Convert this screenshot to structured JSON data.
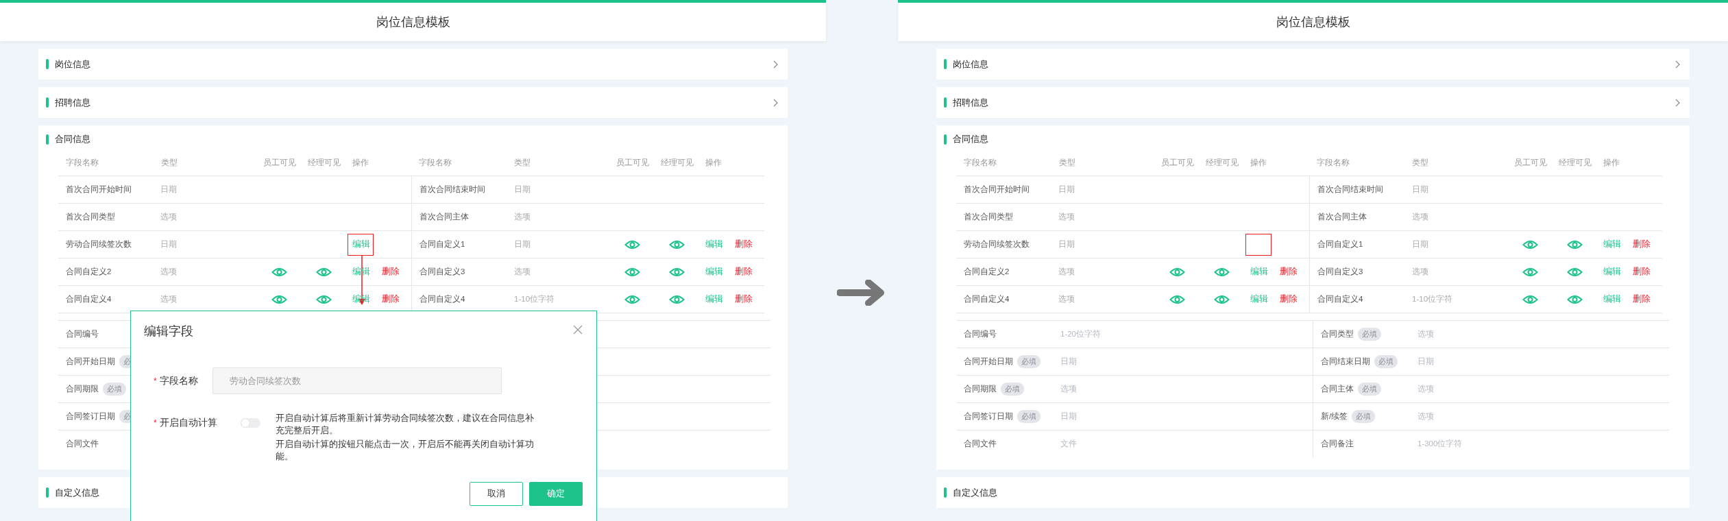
{
  "screens": [
    {
      "title": "岗位信息模板",
      "collapsed_sections": [
        {
          "title": "岗位信息"
        },
        {
          "title": "招聘信息"
        }
      ],
      "contract": {
        "title": "合同信息",
        "column_groups": [
          [
            "字段名称",
            "类型",
            "员工可见",
            "经理可见",
            "操作"
          ],
          [
            "字段名称",
            "类型",
            "员工可见",
            "经理可见",
            "操作"
          ]
        ],
        "rows": [
          {
            "left": {
              "name": "首次合同开始时间",
              "type": "日期",
              "employee_visible": false,
              "manager_visible": false,
              "highlighted": false
            },
            "right": {
              "name": "首次合同结束时间",
              "type": "日期",
              "employee_visible": false,
              "manager_visible": false,
              "highlighted": false
            }
          },
          {
            "left": {
              "name": "首次合同类型",
              "type": "选项",
              "employee_visible": false,
              "manager_visible": false,
              "highlighted": false
            },
            "right": {
              "name": "首次合同主体",
              "type": "选项",
              "employee_visible": false,
              "manager_visible": false,
              "highlighted": false
            }
          },
          {
            "left": {
              "name": "劳动合同续签次数",
              "type": "日期",
              "employee_visible": false,
              "manager_visible": false,
              "edit": "编辑",
              "highlighted": true
            },
            "right": {
              "name": "合同自定义1",
              "type": "日期",
              "employee_visible": true,
              "manager_visible": true,
              "edit": "编辑",
              "delete": "删除",
              "highlighted": false
            }
          },
          {
            "left": {
              "name": "合同自定义2",
              "type": "选项",
              "employee_visible": true,
              "manager_visible": true,
              "edit": "编辑",
              "delete": "删除",
              "highlighted": false
            },
            "right": {
              "name": "合同自定义3",
              "type": "选项",
              "employee_visible": true,
              "manager_visible": true,
              "edit": "编辑",
              "delete": "删除",
              "highlighted": false
            }
          },
          {
            "left": {
              "name": "合同自定义4",
              "type": "选项",
              "employee_visible": true,
              "manager_visible": true,
              "edit": "编辑",
              "delete": "删除",
              "highlighted": false
            },
            "right": {
              "name": "合同自定义4",
              "type": "1-10位字符",
              "employee_visible": true,
              "manager_visible": true,
              "edit": "编辑",
              "delete": "删除",
              "highlighted": false
            }
          }
        ],
        "fields": [
          {
            "left": {
              "name": "合同编号"
            }
          },
          {
            "left": {
              "name": "合同开始日期",
              "tag": "必"
            }
          },
          {
            "left": {
              "name": "合同期限",
              "tag": "必填"
            }
          },
          {
            "left": {
              "name": "合同签订日期",
              "tag": "必"
            }
          },
          {
            "left": {
              "name": "合同文件"
            }
          }
        ]
      },
      "bottom_section": {
        "title": "自定义信息"
      },
      "dialog": {
        "title": "编辑字段",
        "fields": [
          {
            "kind": "input",
            "mark": "*",
            "label": "字段名称",
            "value": "劳动合同续签次数",
            "disabled": true
          },
          {
            "kind": "toggle",
            "mark": "*",
            "label": "开启自动计算",
            "on": false,
            "description": [
              "开启自动计算后将重新计算劳动合同续签次数，建议在合同信息补充完整后开启。",
              "开启自动计算的按钮只能点击一次，开启后不能再关闭自动计算功能。"
            ]
          }
        ],
        "buttons": [
          {
            "label": "取消",
            "primary": false
          },
          {
            "label": "确定",
            "primary": true
          }
        ]
      }
    },
    {
      "title": "岗位信息模板",
      "collapsed_sections": [
        {
          "title": "岗位信息"
        },
        {
          "title": "招聘信息"
        }
      ],
      "contract": {
        "title": "合同信息",
        "column_groups": [
          [
            "字段名称",
            "类型",
            "员工可见",
            "经理可见",
            "操作"
          ],
          [
            "字段名称",
            "类型",
            "员工可见",
            "经理可见",
            "操作"
          ]
        ],
        "rows": [
          {
            "left": {
              "name": "首次合同开始时间",
              "type": "日期",
              "employee_visible": false,
              "manager_visible": false,
              "highlighted": false
            },
            "right": {
              "name": "首次合同结束时间",
              "type": "日期",
              "employee_visible": false,
              "manager_visible": false,
              "highlighted": false
            }
          },
          {
            "left": {
              "name": "首次合同类型",
              "type": "选项",
              "employee_visible": false,
              "manager_visible": false,
              "highlighted": false
            },
            "right": {
              "name": "首次合同主体",
              "type": "选项",
              "employee_visible": false,
              "manager_visible": false,
              "highlighted": false
            }
          },
          {
            "left": {
              "name": "劳动合同续签次数",
              "type": "日期",
              "employee_visible": false,
              "manager_visible": false,
              "highlighted": true
            },
            "right": {
              "name": "合同自定义1",
              "type": "日期",
              "employee_visible": true,
              "manager_visible": true,
              "edit": "编辑",
              "delete": "删除",
              "highlighted": false
            }
          },
          {
            "left": {
              "name": "合同自定义2",
              "type": "选项",
              "employee_visible": true,
              "manager_visible": true,
              "edit": "编辑",
              "delete": "删除",
              "highlighted": false
            },
            "right": {
              "name": "合同自定义3",
              "type": "选项",
              "employee_visible": true,
              "manager_visible": true,
              "edit": "编辑",
              "delete": "删除",
              "highlighted": false
            }
          },
          {
            "left": {
              "name": "合同自定义4",
              "type": "选项",
              "employee_visible": true,
              "manager_visible": true,
              "edit": "编辑",
              "delete": "删除",
              "highlighted": false
            },
            "right": {
              "name": "合同自定义4",
              "type": "1-10位字符",
              "employee_visible": true,
              "manager_visible": true,
              "edit": "编辑",
              "delete": "删除",
              "highlighted": false
            }
          }
        ],
        "fields": [
          {
            "left": {
              "name": "合同编号",
              "value": "1-20位字符"
            },
            "right": {
              "name": "合同类型",
              "tag": "必填",
              "value": "选项"
            }
          },
          {
            "left": {
              "name": "合同开始日期",
              "tag": "必填",
              "value": "日期"
            },
            "right": {
              "name": "合同结束日期",
              "tag": "必填",
              "value": "日期"
            }
          },
          {
            "left": {
              "name": "合同期限",
              "tag": "必填",
              "value": "选项"
            },
            "right": {
              "name": "合同主体",
              "tag": "必填",
              "value": "选项"
            }
          },
          {
            "left": {
              "name": "合同签订日期",
              "tag": "必填",
              "value": "日期"
            },
            "right": {
              "name": "新/续签",
              "tag": "必填",
              "value": "选项"
            }
          },
          {
            "left": {
              "name": "合同文件",
              "value": "文件"
            },
            "right": {
              "name": "合同备注",
              "value": "1-300位字符"
            }
          }
        ]
      },
      "bottom_section": {
        "title": "自定义信息"
      }
    }
  ]
}
